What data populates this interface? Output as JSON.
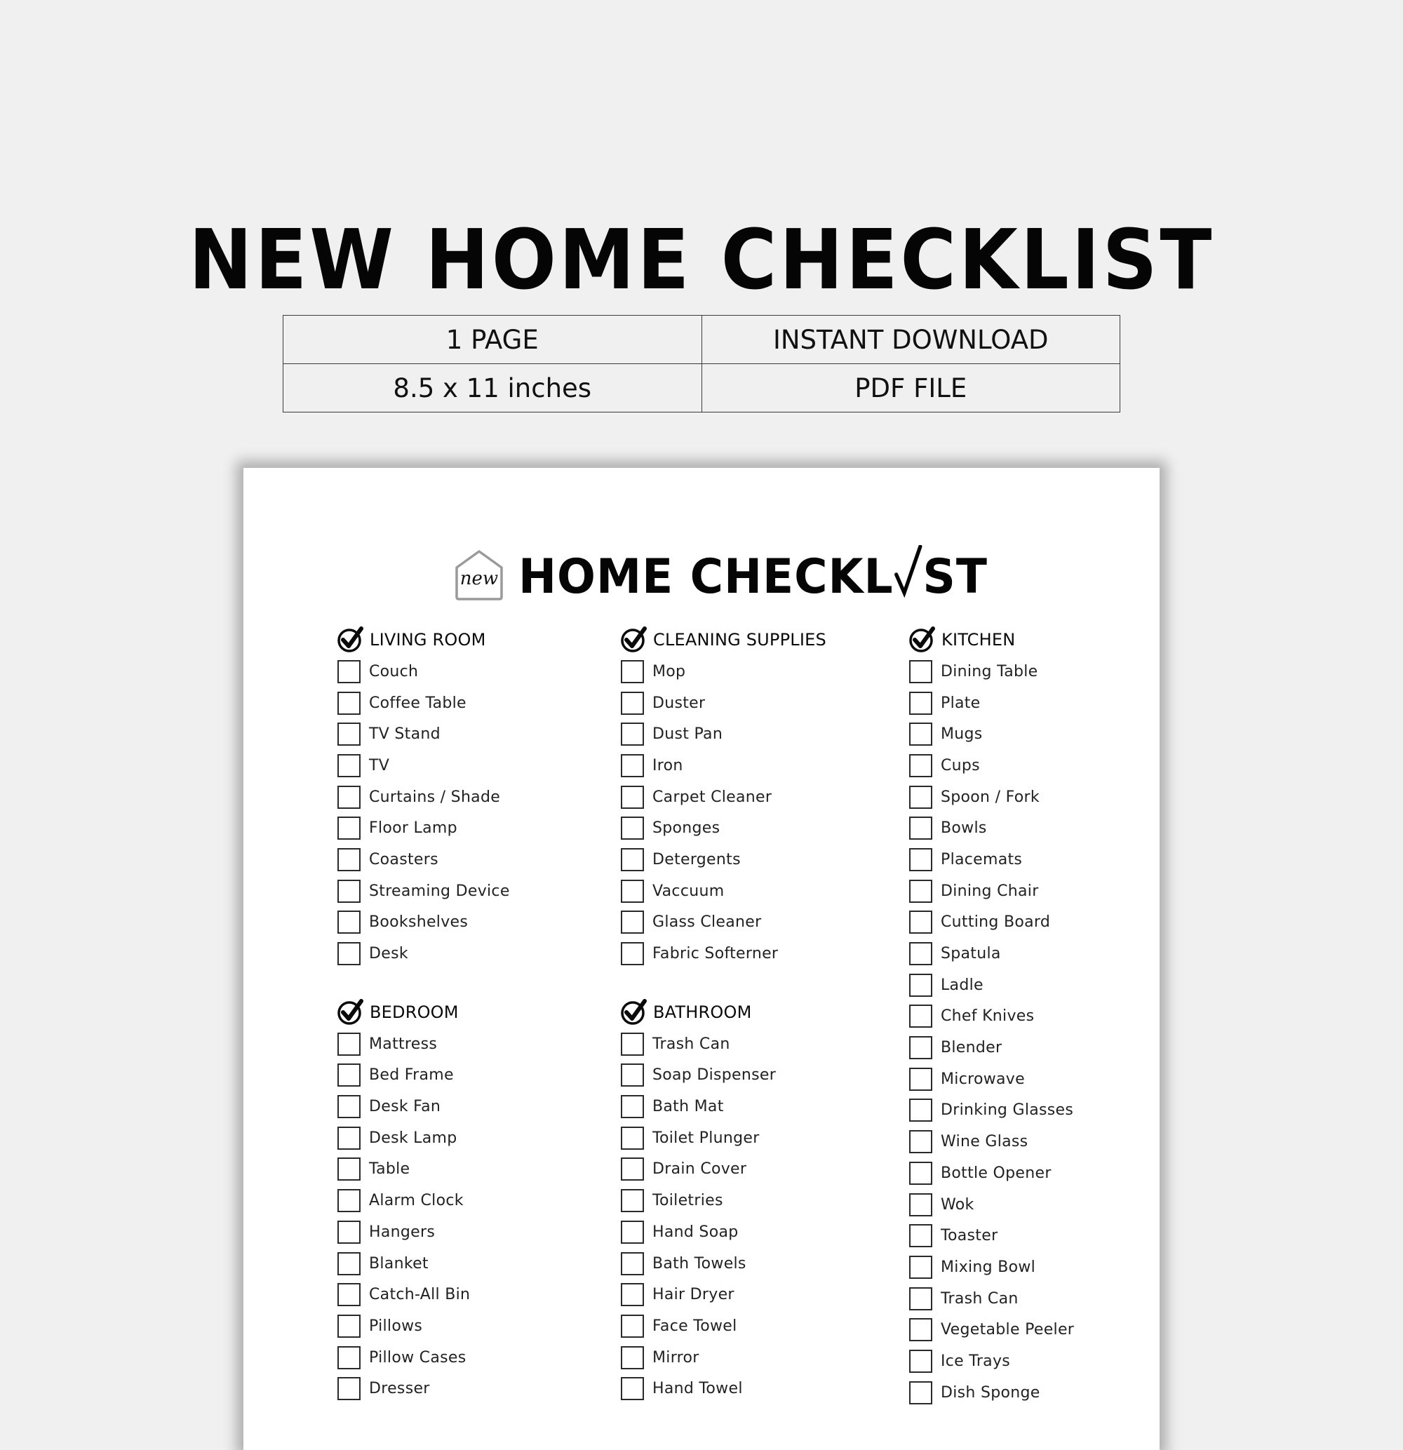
{
  "title": "NEW HOME CHECKLIST",
  "specs": {
    "rows": [
      [
        "1 PAGE",
        "INSTANT DOWNLOAD"
      ],
      [
        "8.5 x 11 inches",
        "PDF FILE"
      ]
    ]
  },
  "document": {
    "logo_badge_text": "new",
    "heading_part1": "HOME CHECKL",
    "heading_part2": "ST",
    "columns": [
      {
        "sections": [
          {
            "title": "LIVING ROOM",
            "icon": "circle-check-icon",
            "items": [
              "Couch",
              "Coffee Table",
              "TV Stand",
              "TV",
              "Curtains / Shade",
              "Floor Lamp",
              "Coasters",
              "Streaming Device",
              "Bookshelves",
              "Desk"
            ]
          },
          {
            "title": "BEDROOM",
            "icon": "circle-check-icon",
            "items": [
              "Mattress",
              "Bed Frame",
              "Desk Fan",
              "Desk Lamp",
              "Table",
              "Alarm Clock",
              "Hangers",
              "Blanket",
              "Catch-All Bin",
              "Pillows",
              "Pillow Cases",
              "Dresser"
            ]
          }
        ]
      },
      {
        "sections": [
          {
            "title": "CLEANING SUPPLIES",
            "icon": "circle-check-icon",
            "items": [
              "Mop",
              "Duster",
              "Dust Pan",
              "Iron",
              "Carpet Cleaner",
              "Sponges",
              "Detergents",
              "Vaccuum",
              "Glass Cleaner",
              "Fabric Softerner"
            ]
          },
          {
            "title": "BATHROOM",
            "icon": "circle-check-icon",
            "items": [
              "Trash Can",
              "Soap Dispenser",
              "Bath Mat",
              "Toilet Plunger",
              "Drain Cover",
              "Toiletries",
              "Hand Soap",
              "Bath Towels",
              "Hair Dryer",
              "Face Towel",
              "Mirror",
              "Hand Towel"
            ]
          }
        ]
      },
      {
        "sections": [
          {
            "title": "KITCHEN",
            "icon": "circle-check-icon",
            "items": [
              "Dining Table",
              "Plate",
              "Mugs",
              "Cups",
              "Spoon / Fork",
              "Bowls",
              "Placemats",
              "Dining Chair",
              "Cutting Board",
              "Spatula",
              "Ladle",
              "Chef Knives",
              "Blender",
              "Microwave",
              "Drinking Glasses",
              "Wine Glass",
              "Bottle Opener",
              "Wok",
              "Toaster",
              "Mixing Bowl",
              "Trash Can",
              "Vegetable Peeler",
              "Ice Trays",
              "Dish Sponge"
            ]
          }
        ]
      }
    ]
  },
  "colors": {
    "background": "#f0f0f0",
    "paper": "#ffffff",
    "ink": "#111111",
    "house_outline": "#9a9a9a"
  }
}
